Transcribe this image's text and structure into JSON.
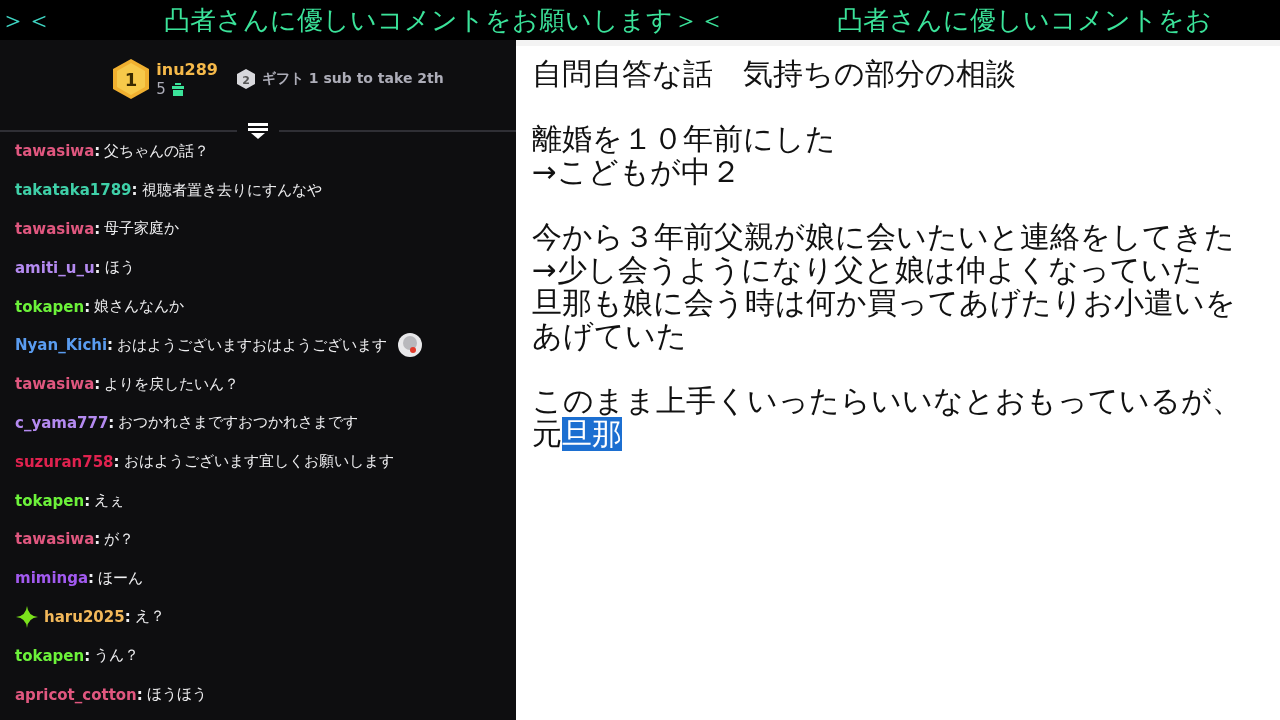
{
  "ticker": [
    "＞＜",
    "凸者さんに優しいコメントをお願いします＞＜",
    "凸者さんに優しいコメントをお"
  ],
  "leaderboard": {
    "first": {
      "rank": "1",
      "name": "inu289",
      "count": "5"
    },
    "second": {
      "rank": "2",
      "text": "ギフト 1 sub to take 2th"
    }
  },
  "chat": [
    {
      "user": "tawasiwa",
      "separator": ":",
      "color": "#e0577f",
      "message": "父ちゃんの話？"
    },
    {
      "user": "takataka1789",
      "separator": ":",
      "color": "#3fd0a8",
      "message": "視聴者置き去りにすんなや"
    },
    {
      "user": "tawasiwa",
      "separator": ":",
      "color": "#e0577f",
      "message": "母子家庭か"
    },
    {
      "user": "amiti_u_u",
      "separator": ":",
      "color": "#b48af0",
      "message": "ほう"
    },
    {
      "user": "tokapen",
      "separator": ":",
      "color": "#6cf23a",
      "message": "娘さんなんか"
    },
    {
      "user": "Nyan_Kichi",
      "separator": ":",
      "color": "#5a9cf0",
      "message": "おはようございますおはようございます",
      "emote": true
    },
    {
      "user": "tawasiwa",
      "separator": ":",
      "color": "#e0577f",
      "message": "よりを戻したいん？"
    },
    {
      "user": "c_yama777",
      "separator": ":",
      "color": "#b48af0",
      "message": "おつかれさまですおつかれさまです"
    },
    {
      "user": "suzuran758",
      "separator": ":",
      "color": "#e0224f",
      "message": "おはようございます宜しくお願いします"
    },
    {
      "user": "tokapen",
      "separator": ":",
      "color": "#6cf23a",
      "message": "えぇ"
    },
    {
      "user": "tawasiwa",
      "separator": ":",
      "color": "#e0577f",
      "message": "が？"
    },
    {
      "user": "miminga",
      "separator": ":",
      "color": "#a25af0",
      "message": "ほーん"
    },
    {
      "user": "haru2025",
      "separator": ":",
      "color": "#f2b85a",
      "message": "え？",
      "badge": true
    },
    {
      "user": "tokapen",
      "separator": ":",
      "color": "#6cf23a",
      "message": "うん？"
    },
    {
      "user": "apricot_cotton",
      "separator": ":",
      "color": "#e0577f",
      "message": "ほうほう"
    }
  ],
  "document": {
    "paragraphs": [
      {
        "lines": [
          [
            {
              "text": "自問自答な話　気持ちの部分の相談",
              "selected": false
            }
          ]
        ]
      },
      {
        "lines": [
          [
            {
              "text": "離婚を１０年前にした",
              "selected": false
            }
          ],
          [
            {
              "text": "→こどもが中２",
              "selected": false
            }
          ]
        ]
      },
      {
        "lines": [
          [
            {
              "text": "今から３年前父親が娘に会いたいと連絡をしてきた",
              "selected": false
            }
          ],
          [
            {
              "text": "→少し会うようになり父と娘は仲よくなっていた",
              "selected": false
            }
          ],
          [
            {
              "text": "旦那も娘に会う時は何か買ってあげたりお小遣いを",
              "selected": false
            }
          ],
          [
            {
              "text": "あげていた",
              "selected": false
            }
          ]
        ]
      },
      {
        "lines": [
          [
            {
              "text": "このまま上手くいったらいいなとおもっているが、",
              "selected": false
            }
          ],
          [
            {
              "text": "元",
              "selected": false
            },
            {
              "text": "旦那",
              "selected": true
            }
          ]
        ]
      }
    ]
  }
}
